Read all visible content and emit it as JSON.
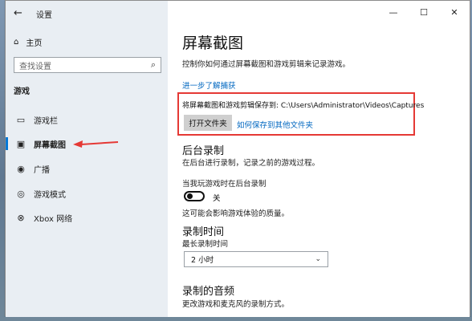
{
  "window": {
    "title": "设置",
    "controls": {
      "minimize": "—",
      "maximize": "☐",
      "close": "✕"
    }
  },
  "sidebar": {
    "home": "主页",
    "search_placeholder": "查找设置",
    "section": "游戏",
    "items": [
      {
        "label": "游戏栏",
        "icon": "game-bar-icon"
      },
      {
        "label": "屏幕截图",
        "icon": "captures-icon",
        "active": true
      },
      {
        "label": "广播",
        "icon": "broadcast-icon"
      },
      {
        "label": "游戏模式",
        "icon": "game-mode-icon"
      },
      {
        "label": "Xbox 网络",
        "icon": "xbox-icon"
      }
    ]
  },
  "main": {
    "title": "屏幕截图",
    "description": "控制你如何通过屏幕截图和游戏剪辑来记录游戏。",
    "learn_more": "进一步了解捕获",
    "save_path": "将屏幕截图和游戏剪辑保存到: C:\\Users\\Administrator\\Videos\\Captures",
    "open_folder": "打开文件夹",
    "save_elsewhere": "如何保存到其他文件夹",
    "background": {
      "title": "后台录制",
      "description": "在后台进行录制，记录之前的游戏过程。",
      "toggle_caption": "当我玩游戏时在后台录制",
      "toggle_state": "关",
      "toggle_on": false,
      "note": "这可能会影响游戏体验的质量。"
    },
    "duration": {
      "title": "录制时间",
      "label": "最长录制时间",
      "value": "2 小时"
    },
    "audio": {
      "title": "录制的音频",
      "description": "更改游戏和麦克风的录制方式。"
    }
  },
  "colors": {
    "accent": "#0078d7",
    "link": "#0067c0",
    "highlight_box": "#e53935",
    "sidebar_bg": "#e9eef3"
  }
}
